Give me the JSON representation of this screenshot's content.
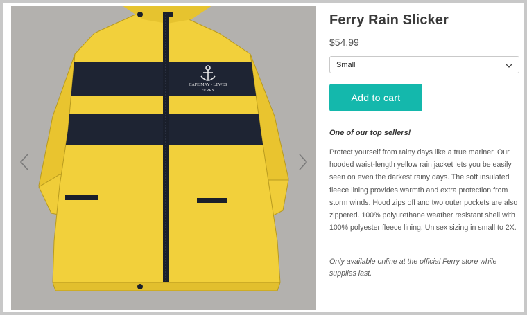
{
  "product": {
    "title": "Ferry Rain Slicker",
    "price": "$54.99",
    "size_select": {
      "selected": "Small"
    },
    "add_to_cart_label": "Add to cart",
    "tagline": "One of our top sellers!",
    "description": "Protect yourself from rainy days like a true mariner. Our hooded waist-length yellow rain jacket lets you be easily seen on even the darkest rainy days. The soft insulated fleece lining provides warmth and extra protection from storm winds. Hood zips off and two outer pockets are also zippered. 100% polyurethane weather resistant shell with 100% polyester fleece lining. Unisex sizing in small to 2X.",
    "availability_note": "Only available online at the official Ferry store while supplies last."
  },
  "gallery": {
    "image_icon": "yellow-rain-jacket-image",
    "prev_icon": "chevron-left-icon",
    "next_icon": "chevron-right-icon",
    "embroidery_line1": "CAPE MAY - LEWES",
    "embroidery_line2": "FERRY"
  },
  "colors": {
    "accent": "#14b8ac",
    "jacket_yellow": "#f2d03b",
    "stripe_navy": "#1e2433",
    "photo_background": "#b3b1ae"
  }
}
